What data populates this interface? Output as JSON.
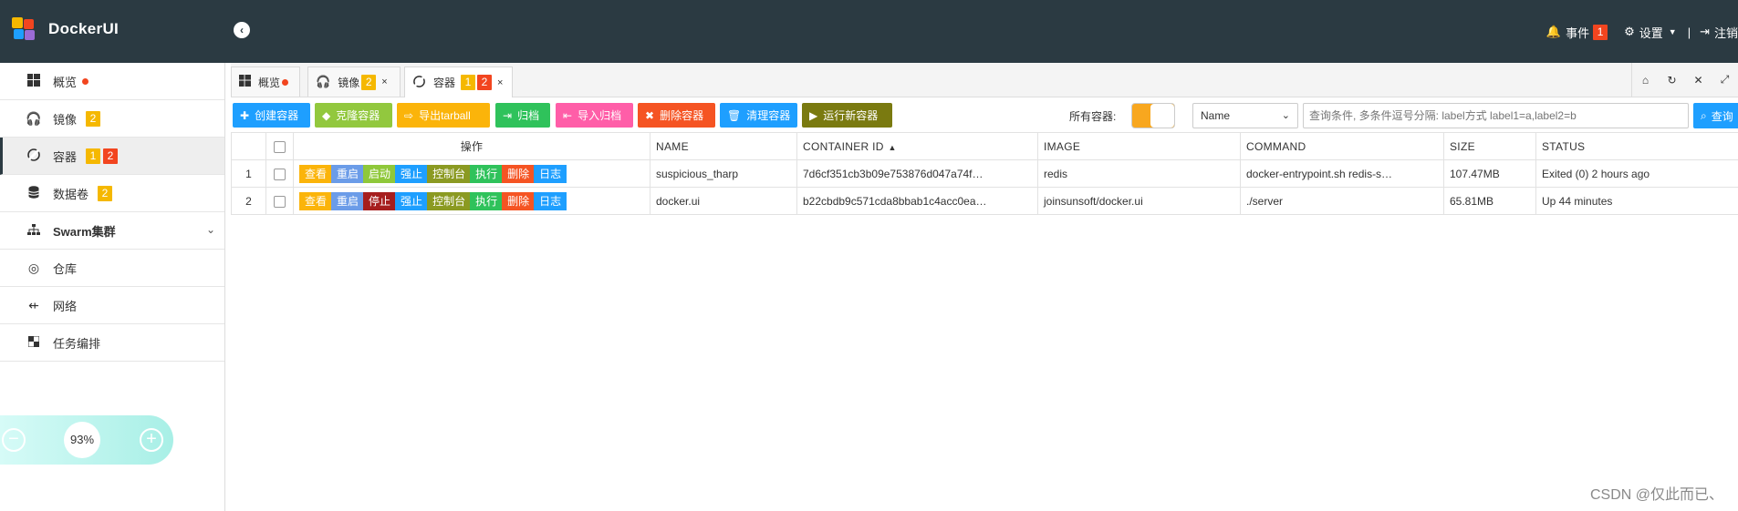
{
  "app": {
    "title": "DockerUI"
  },
  "topnav": {
    "events_label": "事件",
    "events_count": "1",
    "settings_label": "设置",
    "separator": "|",
    "logout_label": "注销"
  },
  "sidebar": {
    "items": [
      {
        "label": "概览",
        "icon": "windows-icon"
      },
      {
        "label": "镜像",
        "icon": "headphones-icon",
        "badge": "2"
      },
      {
        "label": "容器",
        "icon": "container-icon",
        "badge1": "1",
        "badge2": "2"
      },
      {
        "label": "数据卷",
        "icon": "database-icon",
        "badge": "2"
      },
      {
        "label": "Swarm集群",
        "icon": "sitemap-icon"
      },
      {
        "label": "仓库",
        "icon": "podcast-icon"
      },
      {
        "label": "网络",
        "icon": "usb-icon"
      },
      {
        "label": "任务编排",
        "icon": "checkerboard-icon"
      }
    ]
  },
  "zoom": {
    "value": "93%"
  },
  "tabs": [
    {
      "label": "概览"
    },
    {
      "label": "镜像",
      "badge": "2"
    },
    {
      "label": "容器",
      "badge1": "1",
      "badge2": "2"
    }
  ],
  "toolbar": {
    "buttons": [
      {
        "label": "创建容器",
        "color": "#1e9fff"
      },
      {
        "label": "克隆容器",
        "color": "#92c83e"
      },
      {
        "label": "导出tarball",
        "color": "#fbb40a"
      },
      {
        "label": "归档",
        "color": "#2fc25b"
      },
      {
        "label": "导入归档",
        "color": "#ff5ea8"
      },
      {
        "label": "删除容器",
        "color": "#f55423"
      },
      {
        "label": "清理容器",
        "color": "#1e9fff"
      },
      {
        "label": "运行新容器",
        "color": "#7a7a10"
      }
    ],
    "all_containers_label": "所有容器:",
    "filter_select": "Name",
    "search_placeholder": "查询条件, 多条件逗号分隔: label方式 label1=a,label2=b",
    "search_button": "查询"
  },
  "table": {
    "headers": {
      "ops": "操作",
      "name": "NAME",
      "container_id": "CONTAINER ID",
      "image": "IMAGE",
      "command": "COMMAND",
      "size": "SIZE",
      "status": "STATUS"
    },
    "rows": [
      {
        "index": "1",
        "actions": [
          "查看",
          "重启",
          "启动",
          "强止",
          "控制台",
          "执行",
          "删除",
          "日志"
        ],
        "name": "suspicious_tharp",
        "container_id": "7d6cf351cb3b09e753876d047a74f…",
        "image": "redis",
        "command": "docker-entrypoint.sh redis-s…",
        "size": "107.47MB",
        "status": "Exited (0) 2 hours ago"
      },
      {
        "index": "2",
        "actions": [
          "查看",
          "重启",
          "停止",
          "强止",
          "控制台",
          "执行",
          "删除",
          "日志"
        ],
        "name": "docker.ui",
        "container_id": "b22cbdb9c571cda8bbab1c4acc0ea…",
        "image": "joinsunsoft/docker.ui",
        "command": "./server",
        "size": "65.81MB",
        "status": "Up 44 minutes"
      }
    ]
  },
  "watermark": "CSDN @仅此而已、"
}
